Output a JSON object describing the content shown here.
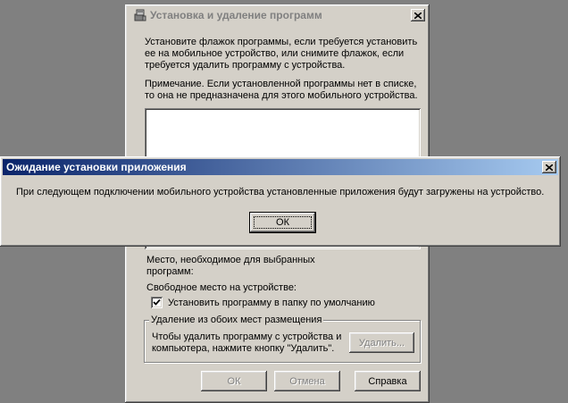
{
  "main_window": {
    "title": "Установка и удаление программ",
    "instructions": [
      "Установите флажок программы, если требуется установить",
      "ее на мобильное устройство, или снимите флажок, если",
      "требуется удалить программу с устройства."
    ],
    "note": [
      "Примечание.  Если установленной программы нет в списке,",
      "то она не предназначена для этого мобильного устройства."
    ],
    "space_required": [
      "Место, необходимое для выбранных",
      "программ:"
    ],
    "free_space": "Свободное место на устройстве:",
    "default_folder_checkbox": {
      "label": "Установить программу в папку по умолчанию",
      "checked": true
    },
    "remove_group": {
      "title": "Удаление из обоих мест размещения",
      "text": [
        "Чтобы удалить программу с устройства и",
        "компьютера, нажмите кнопку \"Удалить\"."
      ],
      "remove_button": "Удалить..."
    },
    "buttons": {
      "ok": "ОК",
      "cancel": "Отмена",
      "help": "Справка"
    }
  },
  "modal": {
    "title": "Ожидание установки приложения",
    "message": "При следующем подключении мобильного устройства установленные приложения будут загружены на устройство.",
    "ok_button": "ОК"
  },
  "icons": {
    "main_title_icon": "program-install-icon",
    "close": "close-icon",
    "checkmark": "checkmark-icon"
  },
  "colors": {
    "desktop": "#808080",
    "face": "#d4d0c8",
    "active_title_start": "#0a246a",
    "active_title_end": "#a6caf0",
    "inactive_title_text": "#808080"
  }
}
